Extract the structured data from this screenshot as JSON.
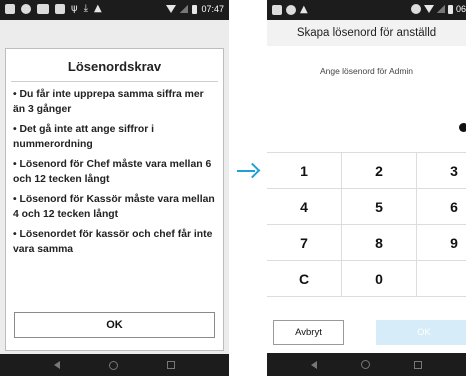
{
  "left_phone": {
    "status_bar": {
      "time": "07:47"
    },
    "dialog": {
      "title": "Lösenordskrav",
      "rules": [
        "• Du får inte upprepa samma siffra mer än 3 gånger",
        "• Det gå inte att ange siffror i nummerordning",
        "• Lösenord för Chef måste vara mellan 6 och 12 tecken långt",
        "• Lösenord för Kassör måste vara mellan 4 och 12 tecken långt",
        "• Lösenordet för kassör och chef får inte vara samma"
      ],
      "ok_label": "OK"
    }
  },
  "right_phone": {
    "status_bar": {
      "time": "06"
    },
    "title": "Skapa lösenord för anställd",
    "prompt": "Ange lösenord för Admin",
    "keypad": [
      [
        "1",
        "2",
        "3"
      ],
      [
        "4",
        "5",
        "6"
      ],
      [
        "7",
        "8",
        "9"
      ],
      [
        "C",
        "0",
        ""
      ]
    ],
    "cancel_label": "Avbryt",
    "ok_label": "OK"
  },
  "colors": {
    "arrow": "#1ea0d8",
    "ok_disabled_bg": "#d6ecf8",
    "status_bar": "#1c1c1c"
  },
  "icons": [
    "wifi-icon",
    "battery-icon",
    "alert-icon",
    "back-nav-icon",
    "home-nav-icon",
    "recents-nav-icon",
    "arrow-right-icon"
  ]
}
